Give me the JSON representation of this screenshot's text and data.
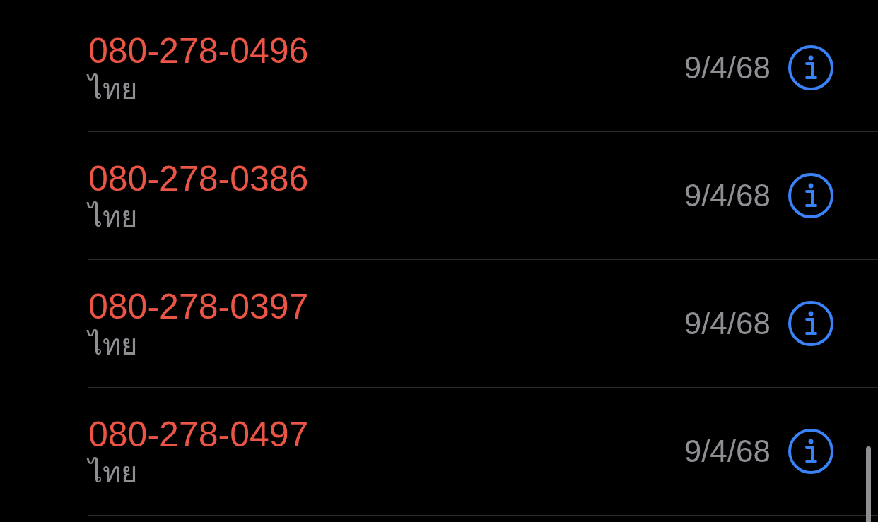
{
  "calls": [
    {
      "number": "080-278-0496",
      "label": "ไทย",
      "date": "9/4/68",
      "missed": true
    },
    {
      "number": "080-278-0386",
      "label": "ไทย",
      "date": "9/4/68",
      "missed": true
    },
    {
      "number": "080-278-0397",
      "label": "ไทย",
      "date": "9/4/68",
      "missed": true
    },
    {
      "number": "080-278-0497",
      "label": "ไทย",
      "date": "9/4/68",
      "missed": true
    }
  ]
}
